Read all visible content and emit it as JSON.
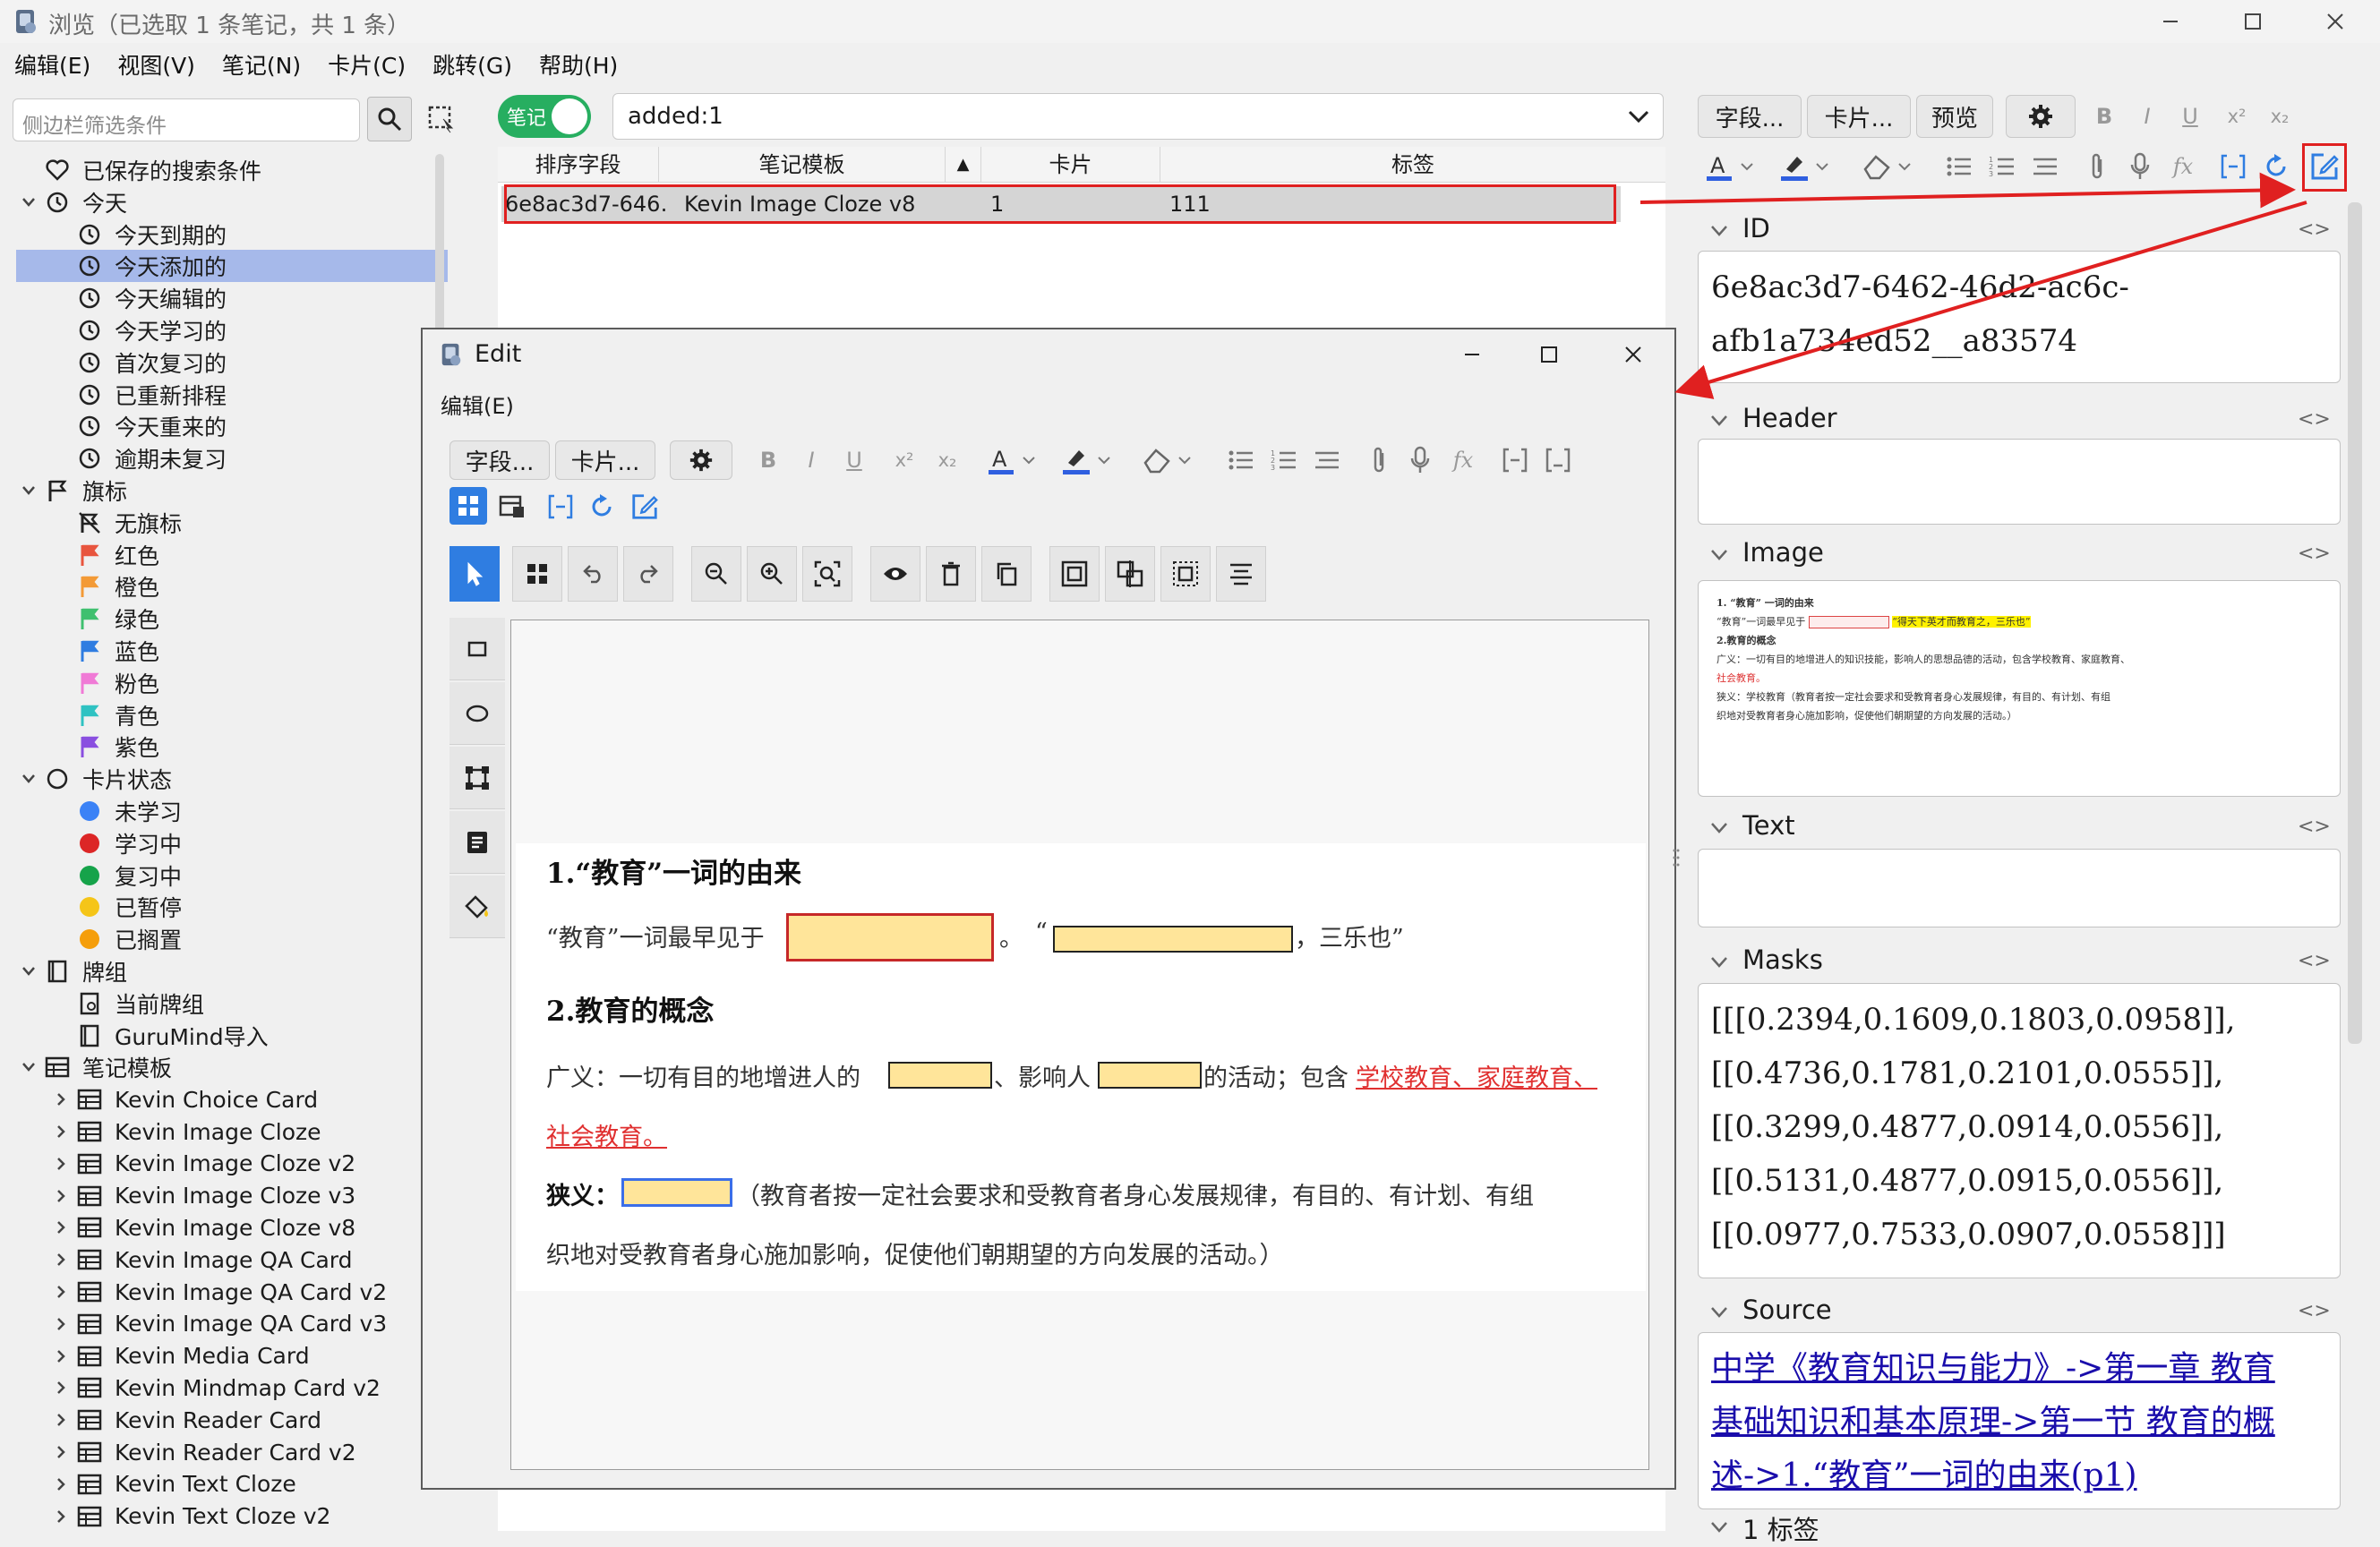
{
  "window": {
    "title": "浏览（已选取 1 条笔记，共 1 条）",
    "menu": [
      "编辑(E)",
      "视图(V)",
      "笔记(N)",
      "卡片(C)",
      "跳转(G)",
      "帮助(H)"
    ]
  },
  "sidebar": {
    "filter_placeholder": "侧边栏筛选条件",
    "items": [
      {
        "label": "已保存的搜索条件",
        "level": 1,
        "icon": "heart-icon",
        "arrow": "",
        "top": 0
      },
      {
        "label": "今天",
        "level": 1,
        "icon": "clock-icon",
        "arrow": "down"
      },
      {
        "label": "今天到期的",
        "level": 2,
        "icon": "clock-icon"
      },
      {
        "label": "今天添加的",
        "level": 2,
        "icon": "clock-icon",
        "selected": true
      },
      {
        "label": "今天编辑的",
        "level": 2,
        "icon": "clock-icon"
      },
      {
        "label": "今天学习的",
        "level": 2,
        "icon": "clock-icon"
      },
      {
        "label": "首次复习的",
        "level": 2,
        "icon": "clock-icon"
      },
      {
        "label": "已重新排程",
        "level": 2,
        "icon": "clock-icon"
      },
      {
        "label": "今天重来的",
        "level": 2,
        "icon": "clock-icon"
      },
      {
        "label": "逾期未复习",
        "level": 2,
        "icon": "clock-icon"
      },
      {
        "label": "旗标",
        "level": 1,
        "icon": "flag-icon",
        "arrow": "down"
      },
      {
        "label": "无旗标",
        "level": 2,
        "icon": "no-flag-icon"
      },
      {
        "label": "红色",
        "level": 2,
        "icon": "flag-icon",
        "color": "#e8553e"
      },
      {
        "label": "橙色",
        "level": 2,
        "icon": "flag-icon",
        "color": "#f39a36"
      },
      {
        "label": "绿色",
        "level": 2,
        "icon": "flag-icon",
        "color": "#3fc06f"
      },
      {
        "label": "蓝色",
        "level": 2,
        "icon": "flag-icon",
        "color": "#2f7de1"
      },
      {
        "label": "粉色",
        "level": 2,
        "icon": "flag-icon",
        "color": "#f07ad6"
      },
      {
        "label": "青色",
        "level": 2,
        "icon": "flag-icon",
        "color": "#2fc2c2"
      },
      {
        "label": "紫色",
        "level": 2,
        "icon": "flag-icon",
        "color": "#8a4fe0"
      },
      {
        "label": "卡片状态",
        "level": 1,
        "icon": "circle-icon",
        "arrow": "down"
      },
      {
        "label": "未学习",
        "level": 2,
        "icon": "dot-icon",
        "color": "#3b82f6"
      },
      {
        "label": "学习中",
        "level": 2,
        "icon": "dot-icon",
        "color": "#dc2626"
      },
      {
        "label": "复习中",
        "level": 2,
        "icon": "dot-icon",
        "color": "#16a34a"
      },
      {
        "label": "已暂停",
        "level": 2,
        "icon": "dot-icon",
        "color": "#f5c518"
      },
      {
        "label": "已搁置",
        "level": 2,
        "icon": "dot-icon",
        "color": "#f59e0b"
      },
      {
        "label": "牌组",
        "level": 1,
        "icon": "deck-icon",
        "arrow": "down"
      },
      {
        "label": "当前牌组",
        "level": 2,
        "icon": "current-deck-icon"
      },
      {
        "label": "GuruMind导入",
        "level": 2,
        "icon": "deck-icon"
      },
      {
        "label": "笔记模板",
        "level": 1,
        "icon": "notetype-icon",
        "arrow": "down"
      },
      {
        "label": "Kevin Choice Card",
        "level": 2,
        "icon": "notetype-icon",
        "arrow": "right"
      },
      {
        "label": "Kevin Image Cloze",
        "level": 2,
        "icon": "notetype-icon",
        "arrow": "right"
      },
      {
        "label": "Kevin Image Cloze v2",
        "level": 2,
        "icon": "notetype-icon",
        "arrow": "right"
      },
      {
        "label": "Kevin Image Cloze v3",
        "level": 2,
        "icon": "notetype-icon",
        "arrow": "right"
      },
      {
        "label": "Kevin Image Cloze v8",
        "level": 2,
        "icon": "notetype-icon",
        "arrow": "right"
      },
      {
        "label": "Kevin Image QA Card",
        "level": 2,
        "icon": "notetype-icon",
        "arrow": "right"
      },
      {
        "label": "Kevin Image QA Card v2",
        "level": 2,
        "icon": "notetype-icon",
        "arrow": "right"
      },
      {
        "label": "Kevin Image QA Card v3",
        "level": 2,
        "icon": "notetype-icon",
        "arrow": "right"
      },
      {
        "label": "Kevin Media Card",
        "level": 2,
        "icon": "notetype-icon",
        "arrow": "right"
      },
      {
        "label": "Kevin Mindmap Card v2",
        "level": 2,
        "icon": "notetype-icon",
        "arrow": "right"
      },
      {
        "label": "Kevin Reader Card",
        "level": 2,
        "icon": "notetype-icon",
        "arrow": "right"
      },
      {
        "label": "Kevin Reader Card v2",
        "level": 2,
        "icon": "notetype-icon",
        "arrow": "right"
      },
      {
        "label": "Kevin Text Cloze",
        "level": 2,
        "icon": "notetype-icon",
        "arrow": "right"
      },
      {
        "label": "Kevin Text Cloze v2",
        "level": 2,
        "icon": "notetype-icon",
        "arrow": "right"
      }
    ]
  },
  "toolbar": {
    "toggle_label": "笔记",
    "search_value": "added:1"
  },
  "table": {
    "columns": [
      "排序字段",
      "笔记模板",
      "卡片",
      "标签"
    ],
    "sort_indicator": "▲",
    "rows": [
      [
        "6e8ac3d7-646…",
        "Kevin Image Cloze v8",
        "1",
        "111"
      ]
    ]
  },
  "editor": {
    "buttons": [
      "字段...",
      "卡片...",
      "预览"
    ],
    "fields": [
      {
        "name": "ID",
        "value": [
          "6e8ac3d7-6462-46d2-ac6c-",
          "afb1a734ed52__a83574"
        ]
      },
      {
        "name": "Header",
        "value": []
      },
      {
        "name": "Image",
        "value": []
      },
      {
        "name": "Text",
        "value": []
      },
      {
        "name": "Masks",
        "value": [
          "[[[0.2394,0.1609,0.1803,0.0958]],",
          "[[0.4736,0.1781,0.2101,0.0555]],",
          "[[0.3299,0.4877,0.0914,0.0556]],",
          "[[0.5131,0.4877,0.0915,0.0556]],",
          "[[0.0977,0.7533,0.0907,0.0558]]]"
        ]
      },
      {
        "name": "Source",
        "value": [
          "中学《教育知识与能力》->第一章 教育",
          "基础知识和基本原理->第一节 教育的概",
          "述->1.“教育”一词的由来(p1)"
        ]
      },
      {
        "name": "1 标签",
        "value": []
      }
    ],
    "field_code_glyph": "<>"
  },
  "image_thumb": {
    "lines": [
      "1. “教育” 一词的由来",
      "“教育”一词最早见于",
      "“得天下英才而教育之，三乐也”",
      "2.教育的概念",
      "广义：一切有目的地增进人的知识技能，影响人的思想品德的活动，包含学校教育、家庭教育、",
      "社会教育。",
      "狭义：学校教育（教育者按一定社会要求和受教育者身心发展规律，有目的、有计划、有组",
      "织地对受教育者身心施加影响，促使他们朝期望的方向发展的活动。）"
    ]
  },
  "edit_window": {
    "title": "Edit",
    "menu": "编辑(E)",
    "buttons": [
      "字段...",
      "卡片..."
    ]
  },
  "document": {
    "h1": "1.“教育”一词的由来",
    "p1_a": "“教育”一词最早见于",
    "p1_b": "。",
    "p1_c": "“",
    "p1_d": "，三乐也”",
    "h2": "2.教育的概念",
    "p2_a": "广义：一切有目的地增进人的",
    "p2_b": "、影响人",
    "p2_c": "的活动；包含",
    "p2_d": "学校教育、家庭教育、",
    "p2_e": "社会教育。",
    "p3_a": "狭义：",
    "p3_b": "（教育者按一定社会要求和受教育者身心发展规律，有目的、有计划、有组",
    "p3_c": "织地对受教育者身心施加影响，促使他们朝期望的方向发展的活动。）"
  },
  "colors": {
    "accent_red": "#e02020",
    "toggle_green": "#27ae60",
    "link_blue": "#1a0dab",
    "mask_fill": "#ffe59a",
    "selection": "#a6b9ea"
  }
}
